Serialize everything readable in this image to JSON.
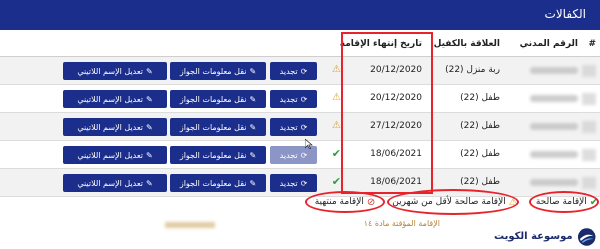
{
  "header": {
    "title": "الكفالات"
  },
  "columns": {
    "num": "#",
    "civil_id": "الرقم المدني",
    "relationship": "العلاقة بالكفيل",
    "expiry": "تاريخ إنتهاء الإقامة"
  },
  "rows": [
    {
      "relationship": "ربة منزل (22)",
      "expiry": "20/12/2020",
      "status": "warning"
    },
    {
      "relationship": "طفل (22)",
      "expiry": "20/12/2020",
      "status": "warning"
    },
    {
      "relationship": "طفل (22)",
      "expiry": "27/12/2020",
      "status": "warning"
    },
    {
      "relationship": "طفل (22)",
      "expiry": "18/06/2021",
      "status": "valid"
    },
    {
      "relationship": "طفل (22)",
      "expiry": "18/06/2021",
      "status": "valid"
    }
  ],
  "actions": {
    "renew": "تجديد",
    "passport": "نقل معلومات الجواز",
    "latin": "تعديل الإسم اللاتيني"
  },
  "legend": {
    "valid": "الإقامة صالحة",
    "expiring": "الإقامة صالحة لأقل من شهرين",
    "ended": "الإقامة منتهية"
  },
  "note": "الإقامة المؤقتة مادة ١٤",
  "logo": {
    "text": "موسوعة الكويت"
  },
  "colors": {
    "header": "#1c2e8c",
    "button": "#1c2e8c",
    "highlight": "#e8232b",
    "valid": "#2e9e3a",
    "warning": "#e8a01c",
    "ended": "#d23a3a"
  },
  "icons": {
    "renew": "refresh-icon",
    "passport": "edit-icon",
    "latin": "edit-icon",
    "valid": "check-icon",
    "warning": "warning-icon",
    "ended": "ban-icon"
  }
}
